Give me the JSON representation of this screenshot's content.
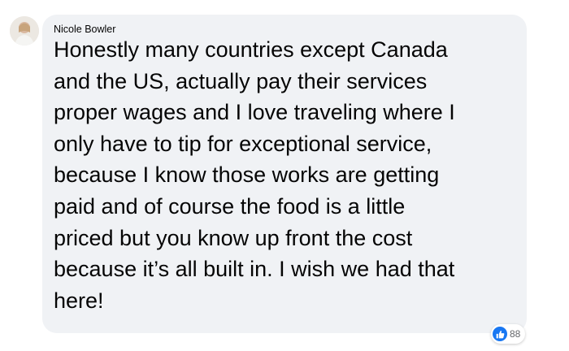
{
  "comment": {
    "author": "Nicole Bowler",
    "text_lines": [
      "Honestly many countries except Canada",
      "and the US, actually pay their services",
      "proper wages and I love traveling where I",
      "only have to tip for exceptional service,",
      "because I know those works are getting",
      "paid and of course the food is a little",
      "priced but you know up front the cost",
      "because it’s all built in. I wish we had that",
      "here!"
    ],
    "reactions": {
      "icon": "thumbs-up-icon",
      "count": "88",
      "color": "#1877f2"
    }
  },
  "colors": {
    "bubble_background": "#f0f2f5",
    "text": "#050505",
    "muted": "#65676b"
  }
}
